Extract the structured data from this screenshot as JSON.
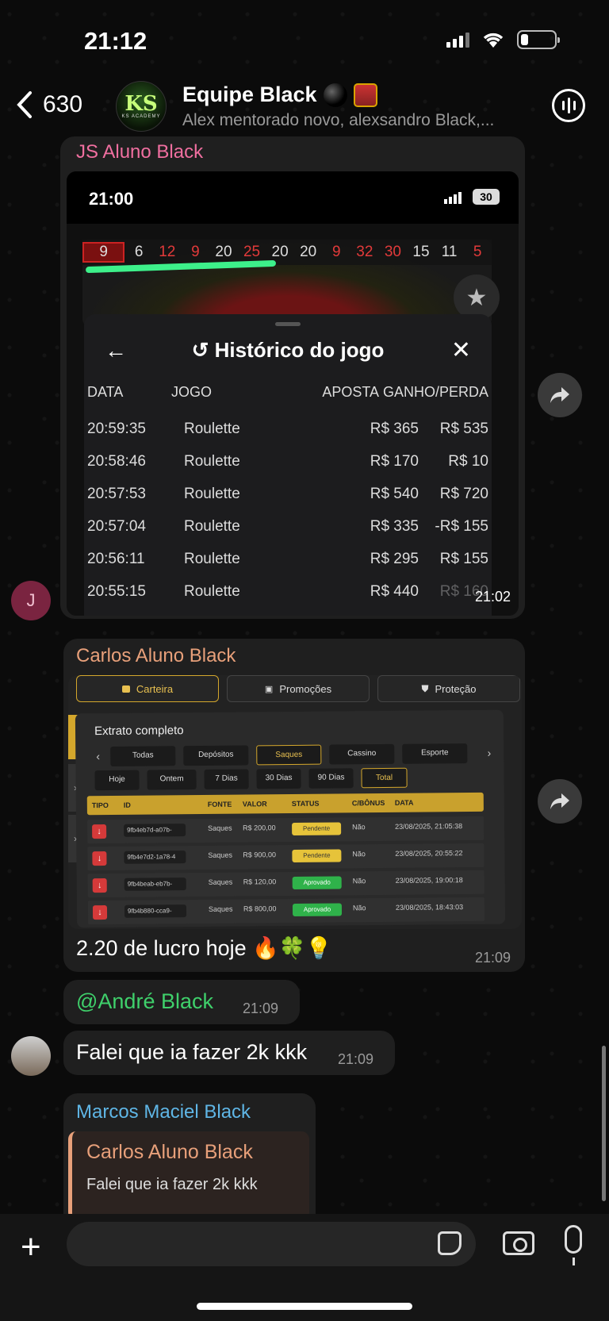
{
  "status_bar": {
    "time": "21:12"
  },
  "header": {
    "back_count": "630",
    "avatar_text": "KS",
    "avatar_subtext": "KS ACADEMY",
    "title": "Equipe Black",
    "subtitle": "Alex mentorado novo, alexsandro Black,..."
  },
  "messages": [
    {
      "sender": "JS Aluno Black",
      "sender_color": "#f06fa0",
      "avatar_letter": "J",
      "time": "21:02",
      "screenshot": {
        "time": "21:00",
        "battery": "30",
        "numbers": [
          "9",
          "6",
          "12",
          "9",
          "20",
          "25",
          "20",
          "20",
          "9",
          "32",
          "30",
          "15",
          "11",
          "5"
        ],
        "panel_title": "Histórico do jogo",
        "columns": {
          "data": "DATA",
          "jogo": "JOGO",
          "aposta": "APOSTA",
          "ganho": "GANHO/PERDA"
        },
        "rows": [
          {
            "data": "20:59:35",
            "jogo": "Roulette",
            "aposta": "R$ 365",
            "ganho": "R$ 535"
          },
          {
            "data": "20:58:46",
            "jogo": "Roulette",
            "aposta": "R$ 170",
            "ganho": "R$ 10"
          },
          {
            "data": "20:57:53",
            "jogo": "Roulette",
            "aposta": "R$ 540",
            "ganho": "R$ 720"
          },
          {
            "data": "20:57:04",
            "jogo": "Roulette",
            "aposta": "R$ 335",
            "ganho": "-R$ 155"
          },
          {
            "data": "20:56:11",
            "jogo": "Roulette",
            "aposta": "R$ 295",
            "ganho": "R$ 155"
          },
          {
            "data": "20:55:15",
            "jogo": "Roulette",
            "aposta": "R$ 440",
            "ganho": "R$ 160"
          }
        ]
      }
    },
    {
      "sender": "Carlos Aluno Black",
      "sender_color": "#e8a07a",
      "time": "21:09",
      "caption": "2.20 de lucro hoje 🔥🍀💡",
      "screenshot": {
        "tabs": [
          "Carteira",
          "Promoções",
          "Proteção"
        ],
        "title": "Extrato completo",
        "filters": [
          "Todas",
          "Depósitos",
          "Saques",
          "Cassino",
          "Esporte"
        ],
        "periods": [
          "Hoje",
          "Ontem",
          "7 Dias",
          "30 Dias",
          "90 Dias",
          "Total"
        ],
        "columns": [
          "TIPO",
          "ID",
          "FONTE",
          "VALOR",
          "STATUS",
          "C/BÔNUS",
          "DATA"
        ],
        "rows": [
          {
            "id": "9fb4eb7d-a07b-",
            "fonte": "Saques",
            "valor": "R$ 200,00",
            "status": "Pendente",
            "bonus": "Não",
            "data": "23/08/2025, 21:05:38"
          },
          {
            "id": "9fb4e7d2-1a78-4",
            "fonte": "Saques",
            "valor": "R$ 900,00",
            "status": "Pendente",
            "bonus": "Não",
            "data": "23/08/2025, 20:55:22"
          },
          {
            "id": "9fb4beab-eb7b-",
            "fonte": "Saques",
            "valor": "R$ 120,00",
            "status": "Aprovado",
            "bonus": "Não",
            "data": "23/08/2025, 19:00:18"
          },
          {
            "id": "9fb4b880-cca9-",
            "fonte": "Saques",
            "valor": "R$ 800,00",
            "status": "Aprovado",
            "bonus": "Não",
            "data": "23/08/2025, 18:43:03"
          }
        ]
      }
    },
    {
      "mention": "@André Black",
      "time": "21:09"
    },
    {
      "text": "Falei que ia fazer 2k kkk",
      "time": "21:09"
    },
    {
      "sender": "Marcos Maciel Black",
      "sender_color": "#5fb6e6",
      "reply_to_sender": "Carlos Aluno Black",
      "reply_to_text": "Falei que ia fazer 2k kkk"
    }
  ],
  "colors": {
    "mention": "#3fd06b",
    "forward_bg": "#3a3a3a"
  }
}
